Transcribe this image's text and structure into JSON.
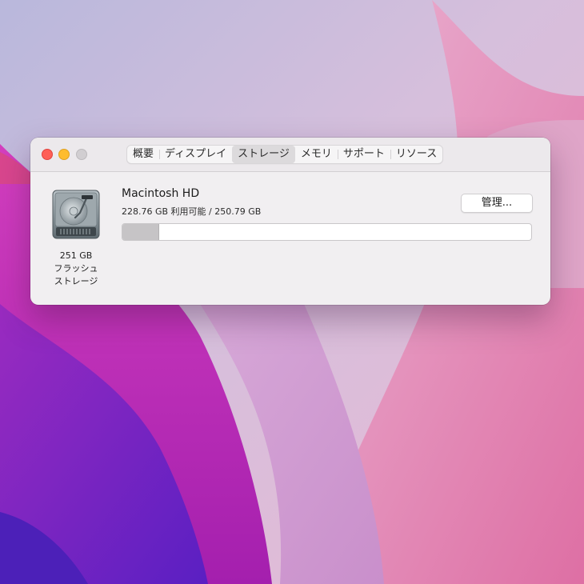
{
  "window": {
    "tabs": [
      {
        "label": "概要",
        "active": false
      },
      {
        "label": "ディスプレイ",
        "active": false
      },
      {
        "label": "ストレージ",
        "active": true
      },
      {
        "label": "メモリ",
        "active": false
      },
      {
        "label": "サポート",
        "active": false
      },
      {
        "label": "リソース",
        "active": false
      }
    ]
  },
  "disk": {
    "icon": "hard-drive-icon",
    "capacity": "251 GB",
    "type_line1": "フラッシュ",
    "type_line2": "ストレージ"
  },
  "volume": {
    "name": "Macintosh HD",
    "info": "228.76 GB 利用可能 / 250.79 GB",
    "used_fraction": 0.088,
    "manage_label": "管理..."
  },
  "colors": {
    "close": "#fe5f57",
    "minimize": "#febc2e",
    "zoom_inactive": "#d1ced1",
    "used_fill": "#c6c4c6"
  }
}
